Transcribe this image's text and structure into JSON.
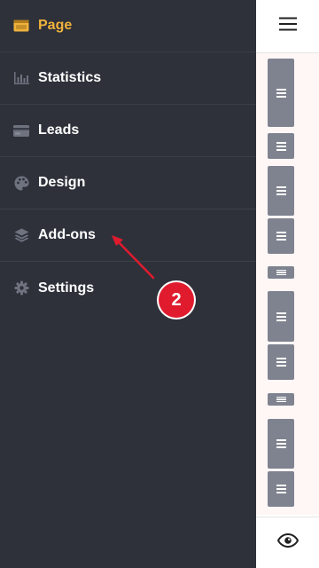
{
  "sidebar": {
    "items": [
      {
        "label": "Page",
        "icon": "browser-window-icon",
        "active": true
      },
      {
        "label": "Statistics",
        "icon": "bar-chart-icon",
        "active": false
      },
      {
        "label": "Leads",
        "icon": "card-icon",
        "active": false
      },
      {
        "label": "Design",
        "icon": "palette-icon",
        "active": false
      },
      {
        "label": "Add-ons",
        "icon": "layers-icon",
        "active": false
      },
      {
        "label": "Settings",
        "icon": "gear-icon",
        "active": false
      }
    ],
    "active_color": "#f0b23c",
    "background": "#2e313a"
  },
  "annotation": {
    "step_number": "2",
    "color": "#e01b2e"
  },
  "preview": {
    "block_color": "#7f838f",
    "background": "#fff6f6"
  }
}
